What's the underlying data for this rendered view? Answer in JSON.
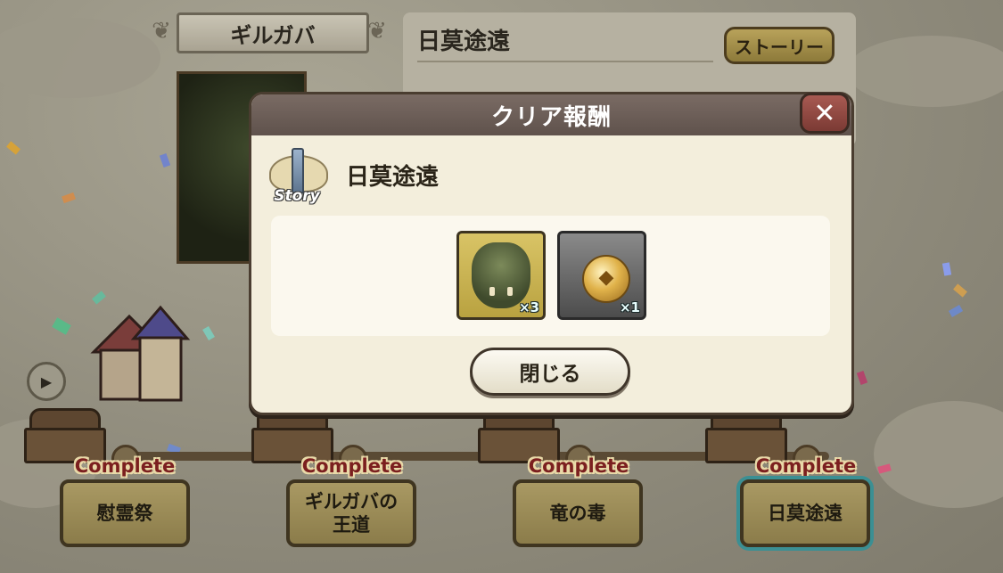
{
  "background": {
    "character_name": "ギルガバ",
    "quest_title": "日莫途遠",
    "story_button_label": "ストーリー"
  },
  "dialog": {
    "title": "クリア報酬",
    "story_emblem_label": "Story",
    "quest_name": "日莫途遠",
    "rewards": [
      {
        "icon": "orc-portrait-icon",
        "quantity": "×3"
      },
      {
        "icon": "gold-coin-icon",
        "quantity": "×1"
      }
    ],
    "close_button_label": "閉じる",
    "close_icon_glyph": "✕"
  },
  "stages": [
    {
      "status": "Complete",
      "name": "慰霊祭"
    },
    {
      "status": "Complete",
      "name": "ギルガバの王道"
    },
    {
      "status": "Complete",
      "name": "竜の毒"
    },
    {
      "status": "Complete",
      "name": "日莫途遠"
    }
  ],
  "colors": {
    "dialog_header": "#6a5c55",
    "close_button": "#8e463f",
    "complete_text": "#7b1f1f",
    "current_stage_outline": "#3b8f93"
  }
}
